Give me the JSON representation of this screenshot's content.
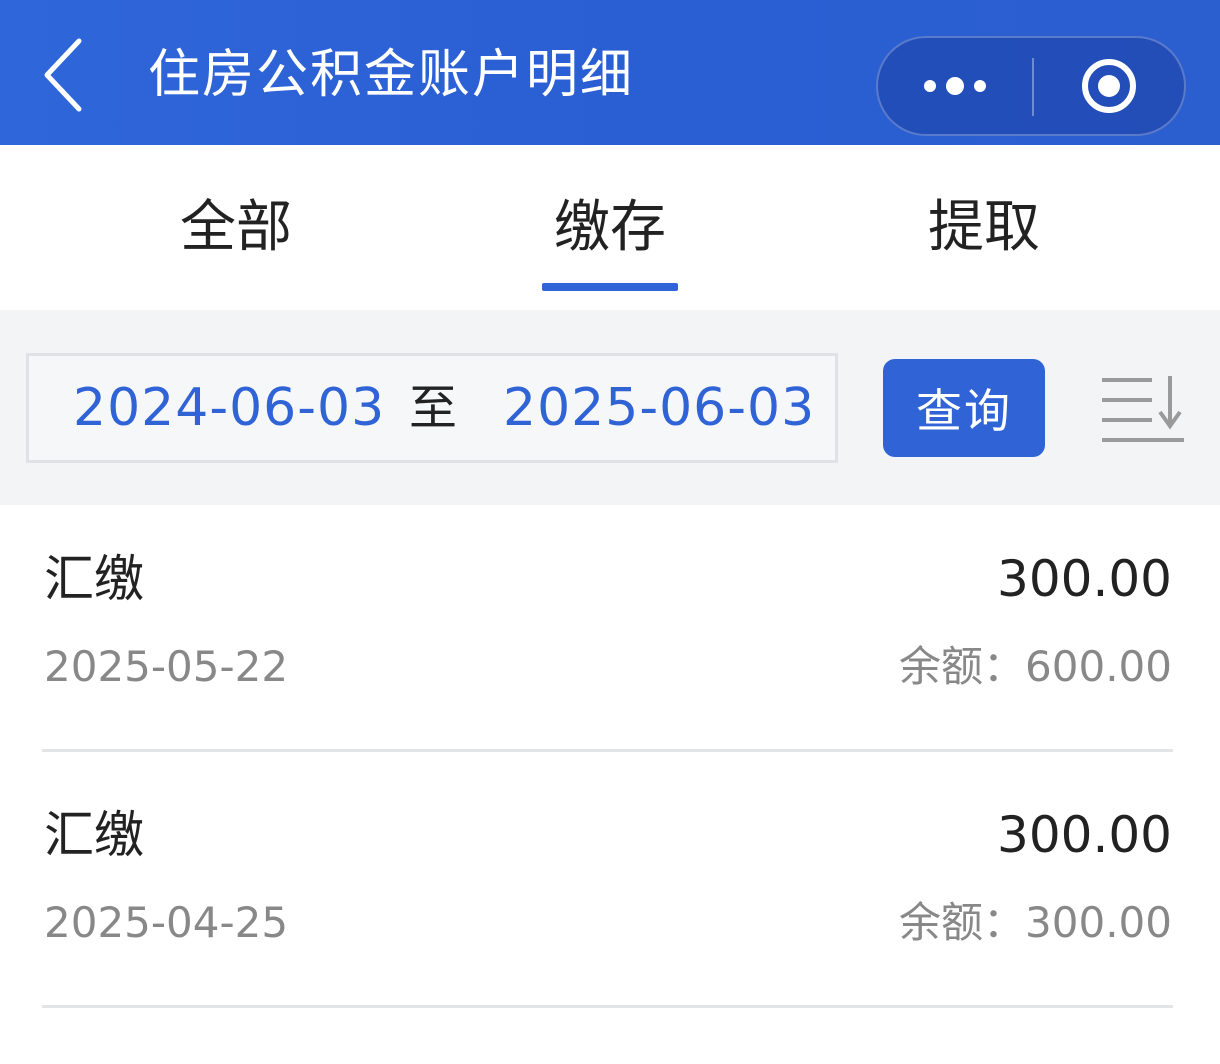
{
  "header": {
    "title": "住房公积金账户明细",
    "back_icon": "chevron-left-icon",
    "more_icon": "more-dots-icon",
    "close_icon": "target-close-icon"
  },
  "tabs": [
    {
      "label": "全部",
      "active": false
    },
    {
      "label": "缴存",
      "active": true
    },
    {
      "label": "提取",
      "active": false
    }
  ],
  "filter": {
    "start_date": "2024-06-03",
    "separator": "至",
    "end_date": "2025-06-03",
    "query_label": "查询",
    "sort_icon": "sort-descending-icon"
  },
  "records": [
    {
      "type": "汇缴",
      "amount": "300.00",
      "date": "2025-05-22",
      "balance_label": "余额：",
      "balance": "600.00"
    },
    {
      "type": "汇缴",
      "amount": "300.00",
      "date": "2025-04-25",
      "balance_label": "余额：",
      "balance": "300.00"
    }
  ],
  "colors": {
    "header_bg": "#2f66d9",
    "accent": "#2f63d6",
    "filter_bg": "#f3f4f6",
    "secondary_text": "#888888"
  }
}
